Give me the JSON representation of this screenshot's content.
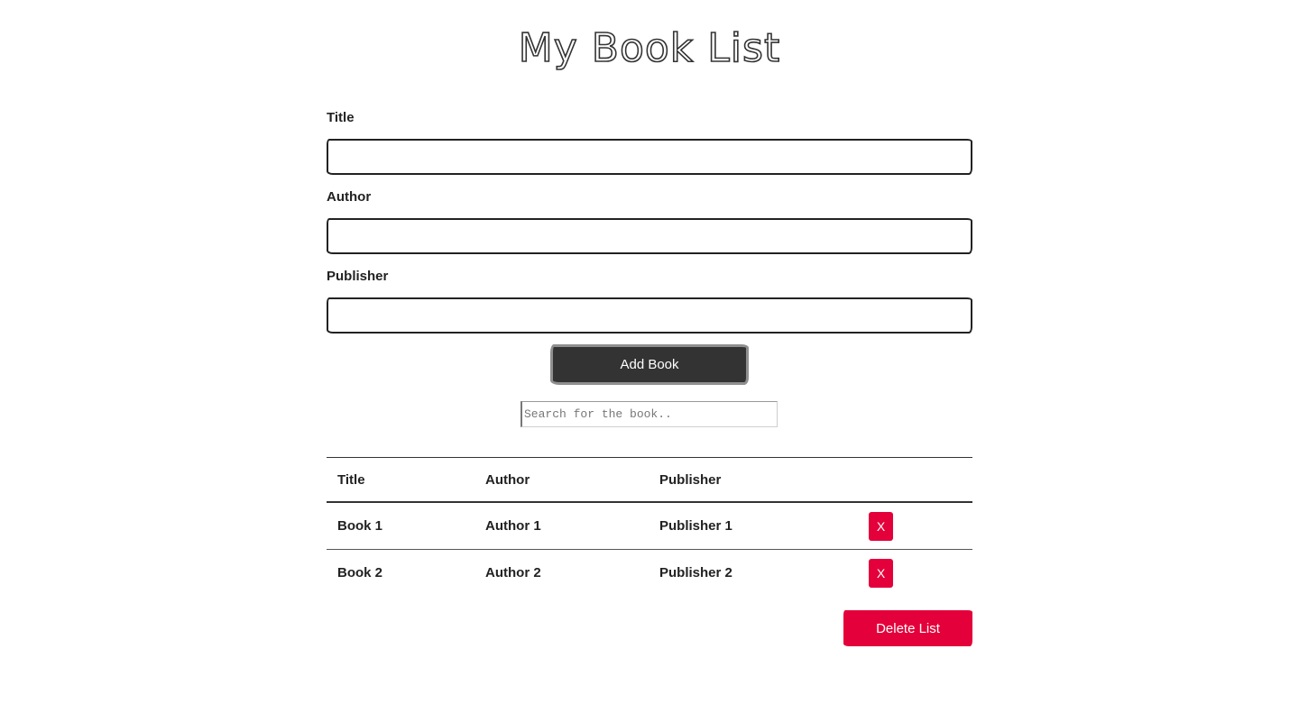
{
  "app": {
    "title": "My Book List"
  },
  "form": {
    "fields": [
      {
        "label": "Title",
        "value": ""
      },
      {
        "label": "Author",
        "value": ""
      },
      {
        "label": "Publisher",
        "value": ""
      }
    ],
    "add_button_label": "Add Book"
  },
  "search": {
    "placeholder": "Search for the book.."
  },
  "table": {
    "headers": [
      "Title",
      "Author",
      "Publisher",
      ""
    ],
    "rows": [
      {
        "title": "Book 1",
        "author": "Author 1",
        "publisher": "Publisher 1",
        "remove_label": "X"
      },
      {
        "title": "Book 2",
        "author": "Author 2",
        "publisher": "Publisher 2",
        "remove_label": "X"
      }
    ]
  },
  "delete_list_label": "Delete List",
  "colors": {
    "primary_dark": "#333333",
    "danger": "#e4003a",
    "background": "#ffffff"
  }
}
